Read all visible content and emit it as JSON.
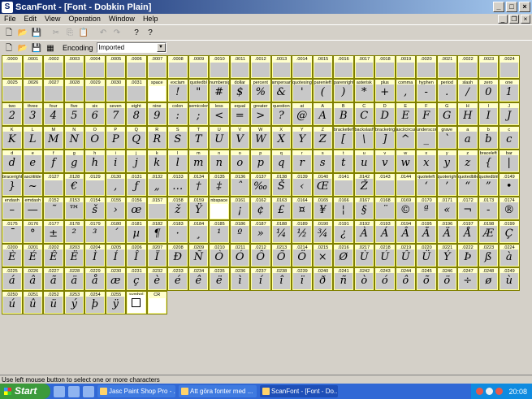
{
  "window": {
    "title": "ScanFont - [Font - Dobkin Plain]",
    "minimize": "_",
    "maximize": "□",
    "close": "×"
  },
  "menu": [
    "File",
    "Edit",
    "View",
    "Operation",
    "Window",
    "Help"
  ],
  "toolbar1": [
    "new-doc-icon",
    "open-folder-icon",
    "save-icon",
    "cut-icon",
    "copy-icon",
    "paste-icon",
    "undo-icon",
    "redo-icon",
    "help-icon",
    "context-help-icon"
  ],
  "toolbar2": {
    "encoding_label": "Encoding",
    "encoding_value": "Imported"
  },
  "cells": [
    {
      "c": ".0000",
      "g": ""
    },
    {
      "c": ".0001",
      "g": ""
    },
    {
      "c": ".0002",
      "g": ""
    },
    {
      "c": ".0003",
      "g": ""
    },
    {
      "c": ".0004",
      "g": ""
    },
    {
      "c": ".0005",
      "g": ""
    },
    {
      "c": ".0006",
      "g": ""
    },
    {
      "c": ".0007",
      "g": ""
    },
    {
      "c": ".0008",
      "g": ""
    },
    {
      "c": ".0009",
      "g": ""
    },
    {
      "c": ".0010",
      "g": ""
    },
    {
      "c": ".0011",
      "g": ""
    },
    {
      "c": ".0012",
      "g": ""
    },
    {
      "c": ".0013",
      "g": ""
    },
    {
      "c": ".0014",
      "g": ""
    },
    {
      "c": ".0015",
      "g": ""
    },
    {
      "c": ".0016",
      "g": ""
    },
    {
      "c": ".0017",
      "g": ""
    },
    {
      "c": ".0018",
      "g": ""
    },
    {
      "c": ".0019",
      "g": ""
    },
    {
      "c": ".0020",
      "g": ""
    },
    {
      "c": ".0021",
      "g": ""
    },
    {
      "c": ".0022",
      "g": ""
    },
    {
      "c": ".0023",
      "g": ""
    },
    {
      "c": ".0024",
      "g": ""
    },
    {
      "c": ".0025",
      "g": ""
    },
    {
      "c": ".0026",
      "g": ""
    },
    {
      "c": ".0027",
      "g": ""
    },
    {
      "c": ".0028",
      "g": ""
    },
    {
      "c": ".0029",
      "g": ""
    },
    {
      "c": ".0030",
      "g": ""
    },
    {
      "c": ".0031",
      "g": ""
    },
    {
      "c": "space",
      "g": ""
    },
    {
      "c": "exclam",
      "g": "!"
    },
    {
      "c": "quotedbl",
      "g": "\""
    },
    {
      "c": "numbersign",
      "g": "#"
    },
    {
      "c": "dollar",
      "g": "$"
    },
    {
      "c": "percent",
      "g": "%"
    },
    {
      "c": "ampersand",
      "g": "&"
    },
    {
      "c": "quotesingle",
      "g": "'"
    },
    {
      "c": "parenleft",
      "g": "("
    },
    {
      "c": "parenright",
      "g": ")"
    },
    {
      "c": "asterisk",
      "g": "*"
    },
    {
      "c": "plus",
      "g": "+"
    },
    {
      "c": "comma",
      "g": ","
    },
    {
      "c": "hyphen",
      "g": "-"
    },
    {
      "c": "period",
      "g": "."
    },
    {
      "c": "slash",
      "g": "/"
    },
    {
      "c": "zero",
      "g": "0"
    },
    {
      "c": "one",
      "g": "1"
    },
    {
      "c": "two",
      "g": "2"
    },
    {
      "c": "three",
      "g": "3"
    },
    {
      "c": "four",
      "g": "4"
    },
    {
      "c": "five",
      "g": "5"
    },
    {
      "c": "six",
      "g": "6"
    },
    {
      "c": "seven",
      "g": "7"
    },
    {
      "c": "eight",
      "g": "8"
    },
    {
      "c": "nine",
      "g": "9"
    },
    {
      "c": "colon",
      "g": ":"
    },
    {
      "c": "semicolon",
      "g": ";"
    },
    {
      "c": "less",
      "g": "<"
    },
    {
      "c": "equal",
      "g": "="
    },
    {
      "c": "greater",
      "g": ">"
    },
    {
      "c": "question",
      "g": "?"
    },
    {
      "c": "at",
      "g": "@"
    },
    {
      "c": "A",
      "g": "A"
    },
    {
      "c": "B",
      "g": "B"
    },
    {
      "c": "C",
      "g": "C"
    },
    {
      "c": "D",
      "g": "D"
    },
    {
      "c": "E",
      "g": "E"
    },
    {
      "c": "F",
      "g": "F"
    },
    {
      "c": "G",
      "g": "G"
    },
    {
      "c": "H",
      "g": "H"
    },
    {
      "c": "I",
      "g": "I"
    },
    {
      "c": "J",
      "g": "J"
    },
    {
      "c": "K",
      "g": "K"
    },
    {
      "c": "L",
      "g": "L"
    },
    {
      "c": "M",
      "g": "M"
    },
    {
      "c": "N",
      "g": "N"
    },
    {
      "c": "O",
      "g": "O"
    },
    {
      "c": "P",
      "g": "P"
    },
    {
      "c": "Q",
      "g": "Q"
    },
    {
      "c": "R",
      "g": "R"
    },
    {
      "c": "S",
      "g": "S"
    },
    {
      "c": "T",
      "g": "T"
    },
    {
      "c": "U",
      "g": "U"
    },
    {
      "c": "V",
      "g": "V"
    },
    {
      "c": "W",
      "g": "W"
    },
    {
      "c": "X",
      "g": "X"
    },
    {
      "c": "Y",
      "g": "Y"
    },
    {
      "c": "Z",
      "g": "Z"
    },
    {
      "c": "bracketleft",
      "g": "["
    },
    {
      "c": "backslash",
      "g": "\\"
    },
    {
      "c": "bracketright",
      "g": "]"
    },
    {
      "c": "asciicircum",
      "g": "^"
    },
    {
      "c": "underscore",
      "g": "_"
    },
    {
      "c": "grave",
      "g": "`"
    },
    {
      "c": "a",
      "g": "a"
    },
    {
      "c": "b",
      "g": "b"
    },
    {
      "c": "c",
      "g": "c"
    },
    {
      "c": "d",
      "g": "d"
    },
    {
      "c": "e",
      "g": "e"
    },
    {
      "c": "f",
      "g": "f"
    },
    {
      "c": "g",
      "g": "g"
    },
    {
      "c": "h",
      "g": "h"
    },
    {
      "c": "i",
      "g": "i"
    },
    {
      "c": "j",
      "g": "j"
    },
    {
      "c": "k",
      "g": "k"
    },
    {
      "c": "l",
      "g": "l"
    },
    {
      "c": "m",
      "g": "m"
    },
    {
      "c": "n",
      "g": "n"
    },
    {
      "c": "o",
      "g": "o"
    },
    {
      "c": "p",
      "g": "p"
    },
    {
      "c": "q",
      "g": "q"
    },
    {
      "c": "r",
      "g": "r"
    },
    {
      "c": "s",
      "g": "s"
    },
    {
      "c": "t",
      "g": "t"
    },
    {
      "c": "u",
      "g": "u"
    },
    {
      "c": "v",
      "g": "v"
    },
    {
      "c": "w",
      "g": "w"
    },
    {
      "c": "x",
      "g": "x"
    },
    {
      "c": "y",
      "g": "y"
    },
    {
      "c": "z",
      "g": "z"
    },
    {
      "c": "braceleft",
      "g": "{"
    },
    {
      "c": "bar",
      "g": "|"
    },
    {
      "c": "braceright",
      "g": "}"
    },
    {
      "c": "asciitilde",
      "g": "~"
    },
    {
      "c": ".0127",
      "g": ""
    },
    {
      "c": ".0128",
      "g": "€"
    },
    {
      "c": ".0129",
      "g": ""
    },
    {
      "c": ".0130",
      "g": ","
    },
    {
      "c": ".0131",
      "g": "ƒ"
    },
    {
      "c": ".0132",
      "g": "„"
    },
    {
      "c": ".0133",
      "g": "…"
    },
    {
      "c": ".0134",
      "g": "†"
    },
    {
      "c": ".0135",
      "g": "‡"
    },
    {
      "c": ".0136",
      "g": "ˆ"
    },
    {
      "c": ".0137",
      "g": "‰"
    },
    {
      "c": ".0138",
      "g": "Š"
    },
    {
      "c": ".0139",
      "g": "‹"
    },
    {
      "c": ".0140",
      "g": "Œ"
    },
    {
      "c": ".0141",
      "g": ""
    },
    {
      "c": ".0142",
      "g": "Ž"
    },
    {
      "c": ".0143",
      "g": ""
    },
    {
      "c": ".0144",
      "g": ""
    },
    {
      "c": "quoteleft",
      "g": "‘"
    },
    {
      "c": "quoteright",
      "g": "’"
    },
    {
      "c": "quotedblleft",
      "g": "“"
    },
    {
      "c": "quotedblright",
      "g": "”"
    },
    {
      "c": ".0149",
      "g": "•"
    },
    {
      "c": "endash",
      "g": "–"
    },
    {
      "c": "emdash",
      "g": "—"
    },
    {
      "c": ".0152",
      "g": "˜"
    },
    {
      "c": ".0153",
      "g": "™"
    },
    {
      "c": ".0154",
      "g": "š"
    },
    {
      "c": ".0155",
      "g": "›"
    },
    {
      "c": ".0156",
      "g": "œ"
    },
    {
      "c": ".0157",
      "g": ""
    },
    {
      "c": ".0158",
      "g": "ž"
    },
    {
      "c": ".0159",
      "g": "Ÿ"
    },
    {
      "c": "nbspace",
      "g": ""
    },
    {
      "c": ".0161",
      "g": "¡"
    },
    {
      "c": ".0162",
      "g": "¢"
    },
    {
      "c": ".0163",
      "g": "£"
    },
    {
      "c": ".0164",
      "g": "¤"
    },
    {
      "c": ".0165",
      "g": "¥"
    },
    {
      "c": ".0166",
      "g": "¦"
    },
    {
      "c": ".0167",
      "g": "§"
    },
    {
      "c": ".0168",
      "g": "¨"
    },
    {
      "c": ".0169",
      "g": "©"
    },
    {
      "c": ".0170",
      "g": "ª"
    },
    {
      "c": ".0171",
      "g": "«"
    },
    {
      "c": ".0172",
      "g": "¬"
    },
    {
      "c": ".0173",
      "g": "-"
    },
    {
      "c": ".0174",
      "g": "®"
    },
    {
      "c": ".0175",
      "g": "¯"
    },
    {
      "c": ".0176",
      "g": "°"
    },
    {
      "c": ".0177",
      "g": "±"
    },
    {
      "c": ".0178",
      "g": "²"
    },
    {
      "c": ".0179",
      "g": "³"
    },
    {
      "c": ".0180",
      "g": "´"
    },
    {
      "c": ".0181",
      "g": "µ"
    },
    {
      "c": ".0182",
      "g": "¶"
    },
    {
      "c": ".0183",
      "g": "·"
    },
    {
      "c": ".0184",
      "g": "¸"
    },
    {
      "c": ".0185",
      "g": "¹"
    },
    {
      "c": ".0186",
      "g": "º"
    },
    {
      "c": ".0187",
      "g": "»"
    },
    {
      "c": ".0188",
      "g": "¼"
    },
    {
      "c": ".0189",
      "g": "½"
    },
    {
      "c": ".0190",
      "g": "¾"
    },
    {
      "c": ".0191",
      "g": "¿"
    },
    {
      "c": ".0192",
      "g": "À"
    },
    {
      "c": ".0193",
      "g": "Á"
    },
    {
      "c": ".0194",
      "g": "Â"
    },
    {
      "c": ".0195",
      "g": "Ã"
    },
    {
      "c": ".0196",
      "g": "Ä"
    },
    {
      "c": ".0197",
      "g": "Å"
    },
    {
      "c": ".0198",
      "g": "Æ"
    },
    {
      "c": ".0199",
      "g": "Ç"
    },
    {
      "c": ".0200",
      "g": "È"
    },
    {
      "c": ".0201",
      "g": "É"
    },
    {
      "c": ".0202",
      "g": "Ê"
    },
    {
      "c": ".0203",
      "g": "Ë"
    },
    {
      "c": ".0204",
      "g": "Ì"
    },
    {
      "c": ".0205",
      "g": "Í"
    },
    {
      "c": ".0206",
      "g": "Î"
    },
    {
      "c": ".0207",
      "g": "Ï"
    },
    {
      "c": ".0208",
      "g": "Ð"
    },
    {
      "c": ".0209",
      "g": "Ñ"
    },
    {
      "c": ".0210",
      "g": "Ò"
    },
    {
      "c": ".0211",
      "g": "Ó"
    },
    {
      "c": ".0212",
      "g": "Ô"
    },
    {
      "c": ".0213",
      "g": "Õ"
    },
    {
      "c": ".0214",
      "g": "Ö"
    },
    {
      "c": ".0215",
      "g": "×"
    },
    {
      "c": ".0216",
      "g": "Ø"
    },
    {
      "c": ".0217",
      "g": "Ù"
    },
    {
      "c": ".0218",
      "g": "Ú"
    },
    {
      "c": ".0219",
      "g": "Û"
    },
    {
      "c": ".0220",
      "g": "Ü"
    },
    {
      "c": ".0221",
      "g": "Ý"
    },
    {
      "c": ".0222",
      "g": "Þ"
    },
    {
      "c": ".0223",
      "g": "ß"
    },
    {
      "c": ".0224",
      "g": "à"
    },
    {
      "c": ".0225",
      "g": "á"
    },
    {
      "c": ".0226",
      "g": "â"
    },
    {
      "c": ".0227",
      "g": "ã"
    },
    {
      "c": ".0228",
      "g": "ä"
    },
    {
      "c": ".0229",
      "g": "å"
    },
    {
      "c": ".0230",
      "g": "æ"
    },
    {
      "c": ".0231",
      "g": "ç"
    },
    {
      "c": ".0232",
      "g": "è"
    },
    {
      "c": ".0233",
      "g": "é"
    },
    {
      "c": ".0234",
      "g": "ê"
    },
    {
      "c": ".0235",
      "g": "ë"
    },
    {
      "c": ".0236",
      "g": "ì"
    },
    {
      "c": ".0237",
      "g": "í"
    },
    {
      "c": ".0238",
      "g": "î"
    },
    {
      "c": ".0239",
      "g": "ï"
    },
    {
      "c": ".0240",
      "g": "ð"
    },
    {
      "c": ".0241",
      "g": "ñ"
    },
    {
      "c": ".0242",
      "g": "ò"
    },
    {
      "c": ".0243",
      "g": "ó"
    },
    {
      "c": ".0244",
      "g": "ô"
    },
    {
      "c": ".0245",
      "g": "õ"
    },
    {
      "c": ".0246",
      "g": "ö"
    },
    {
      "c": ".0247",
      "g": "÷"
    },
    {
      "c": ".0248",
      "g": "ø"
    },
    {
      "c": ".0249",
      "g": "ù"
    },
    {
      "c": ".0250",
      "g": "ú"
    },
    {
      "c": ".0251",
      "g": "û"
    },
    {
      "c": ".0252",
      "g": "ü"
    },
    {
      "c": ".0253",
      "g": "ý"
    },
    {
      "c": ".0254",
      "g": "þ"
    },
    {
      "c": ".0255",
      "g": "ÿ"
    },
    {
      "c": "symbol",
      "g": "☐"
    },
    {
      "c": "CR",
      "g": ""
    }
  ],
  "status": "Use left mouse button to select one or more characters",
  "taskbar": {
    "start": "Start",
    "tasks": [
      "Jasc Paint Shop Pro - ...",
      "Att göra fonter med ...",
      "ScanFont - [Font - Do..."
    ],
    "clock": "20:08"
  }
}
